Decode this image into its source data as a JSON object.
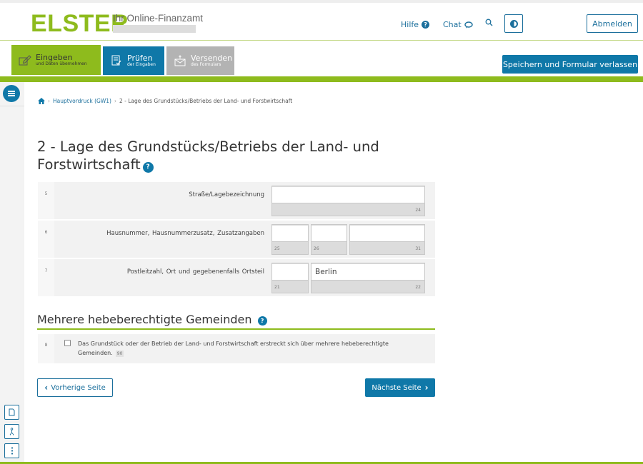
{
  "header": {
    "logo": "ELSTER",
    "tagline": "Ihr Online-Finanzamt",
    "help_label": "Hilfe",
    "chat_label": "Chat",
    "logout_label": "Abmelden",
    "icons": {
      "help": "question-circle-icon",
      "chat": "chat-bubble-icon",
      "search": "search-icon",
      "contrast": "contrast-icon"
    }
  },
  "steps": [
    {
      "title": "Eingeben",
      "subtitle": "und Daten übernehmen",
      "state": "active",
      "icon": "edit-icon"
    },
    {
      "title": "Prüfen",
      "subtitle": "der Eingaben",
      "state": "available",
      "icon": "checklist-icon"
    },
    {
      "title": "Versenden",
      "subtitle": "des Formulars",
      "state": "disabled",
      "icon": "send-mail-icon"
    }
  ],
  "toolbar": {
    "save_leave_label": "Speichern und Formular verlassen"
  },
  "breadcrumb": {
    "parent": "Hauptvordruck (GW1)",
    "current": "2 - Lage des Grundstücks/Betriebs der Land- und Forstwirtschaft"
  },
  "page_title": "2 - Lage des Grundstücks/Betriebs der Land- und Forstwirtschaft",
  "rows": [
    {
      "line": "5",
      "label": "Straße/Lagebezeichnung",
      "fields": [
        {
          "code": "24",
          "value": ""
        }
      ]
    },
    {
      "line": "6",
      "label": "Hausnummer,  Hausnummerzusatz,  Zusatzangaben",
      "fields": [
        {
          "code": "25",
          "value": ""
        },
        {
          "code": "26",
          "value": ""
        },
        {
          "code": "31",
          "value": ""
        }
      ]
    },
    {
      "line": "7",
      "label": "Postleitzahl,  Ort und gegebenenfalls Ortsteil",
      "fields": [
        {
          "code": "21",
          "value": ""
        },
        {
          "code": "22",
          "value": "Berlin"
        }
      ]
    }
  ],
  "section": {
    "title": "Mehrere hebeberechtigte Gemeinden",
    "line": "8",
    "checkbox_label": "Das Grundstück oder der Betrieb der Land- und Forstwirtschaft erstreckt sich über mehrere hebeberechtigte Gemeinden.",
    "checkbox_code": "90",
    "checked": false
  },
  "nav": {
    "prev_label": "Vorherige Seite",
    "next_label": "Nächste Seite"
  },
  "colors": {
    "brand_green": "#8ebb1d",
    "primary_blue": "#0f78a8",
    "disabled_gray": "#b3b3b3"
  }
}
